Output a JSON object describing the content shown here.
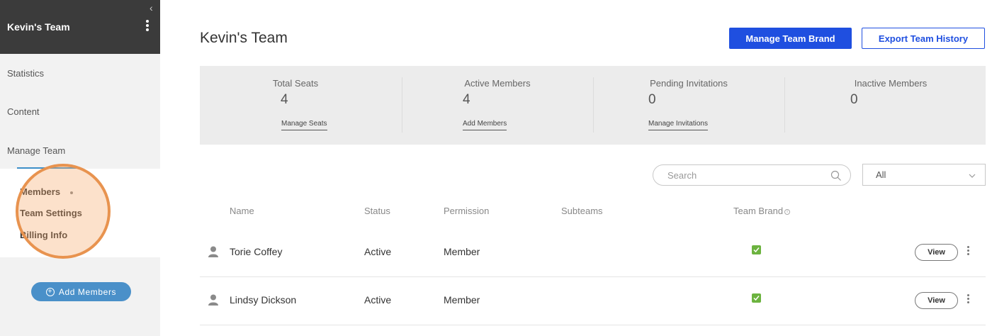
{
  "sidebar": {
    "team_name": "Kevin's Team",
    "collapse_glyph": "‹",
    "nav": [
      {
        "label": "Statistics"
      },
      {
        "label": "Content"
      },
      {
        "label": "Manage Team"
      }
    ],
    "sub_nav": [
      {
        "label": "Members"
      },
      {
        "label": "Team Settings"
      },
      {
        "label": "Billing Info"
      }
    ],
    "add_members_label": "Add Members"
  },
  "header": {
    "title": "Kevin's Team",
    "manage_brand_label": "Manage Team Brand",
    "export_history_label": "Export Team History"
  },
  "stats": [
    {
      "label": "Total Seats",
      "value": "4",
      "link": "Manage Seats"
    },
    {
      "label": "Active Members",
      "value": "4",
      "link": "Add Members"
    },
    {
      "label": "Pending Invitations",
      "value": "0",
      "link": "Manage Invitations"
    },
    {
      "label": "Inactive Members",
      "value": "0",
      "link": ""
    }
  ],
  "filters": {
    "search_placeholder": "Search",
    "select_value": "All"
  },
  "table": {
    "columns": [
      "Name",
      "Status",
      "Permission",
      "Subteams",
      "Team Brand"
    ],
    "rows": [
      {
        "name": "Torie Coffey",
        "status": "Active",
        "permission": "Member",
        "subteams": "",
        "team_brand": true,
        "action": "View"
      },
      {
        "name": "Lindsy Dickson",
        "status": "Active",
        "permission": "Member",
        "subteams": "",
        "team_brand": true,
        "action": "View"
      }
    ]
  },
  "colors": {
    "sidebar_header": "#3b3b3b",
    "primary_blue": "#1f4fe0",
    "add_button_blue": "#4a90c9",
    "check_green": "#6cb33f",
    "highlight_orange": "#e8934f"
  },
  "icons": [
    "chevron-left-icon",
    "kebab-menu-icon",
    "plus-circle-icon",
    "search-icon",
    "chevron-down-icon",
    "info-icon",
    "user-icon",
    "checkbox-checked-icon"
  ]
}
